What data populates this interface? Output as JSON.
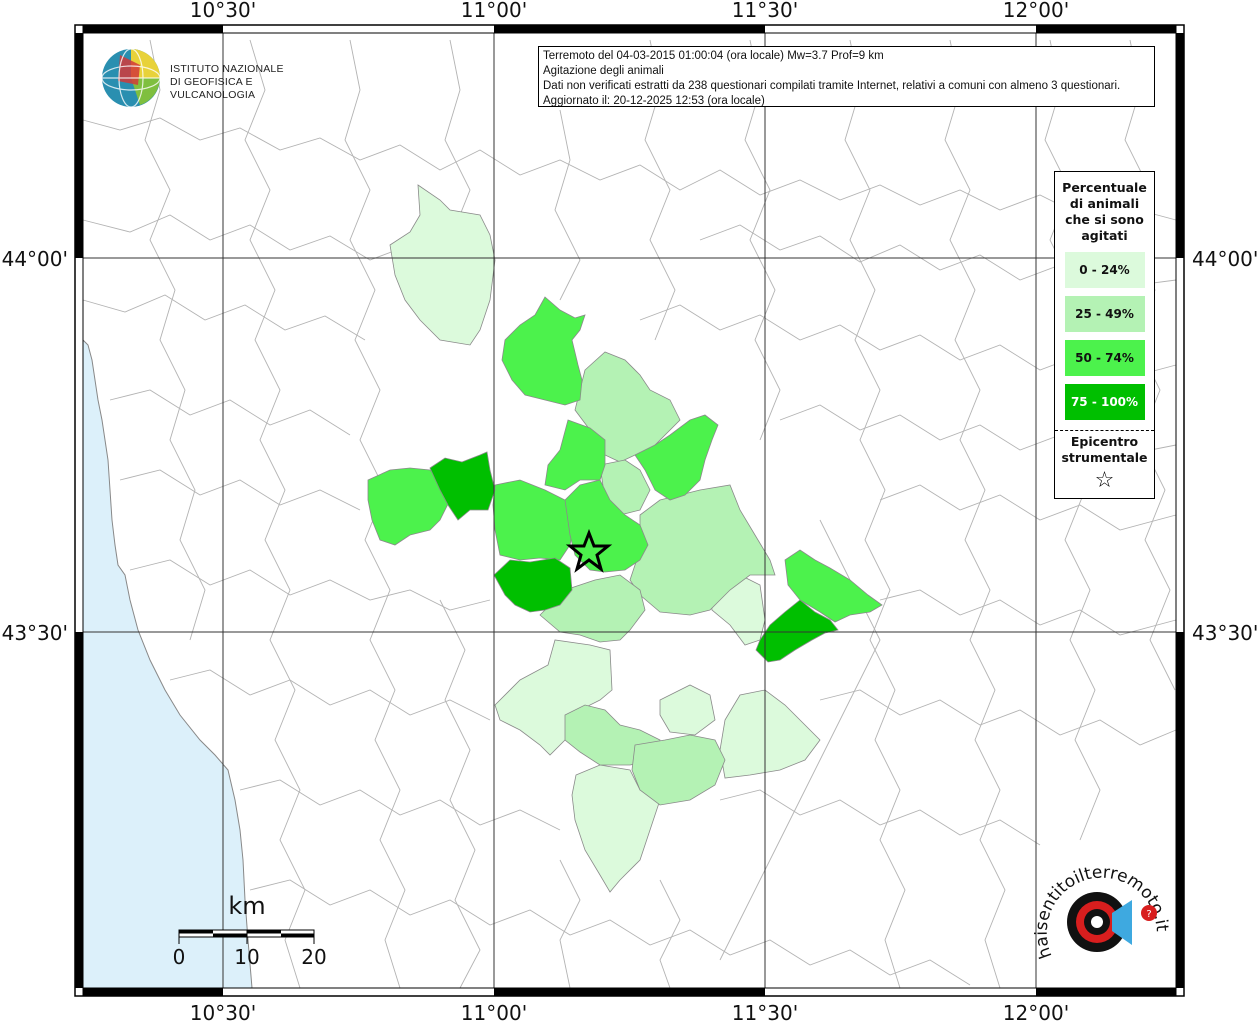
{
  "info": {
    "line1": "Terremoto del 04-03-2015 01:00:04 (ora locale) Mw=3.7 Prof=9 km",
    "line2": "Agitazione degli animali",
    "line3": "Dati non verificati estratti da 238 questionari compilati tramite Internet, relativi a comuni con almeno 3 questionari.",
    "line4": "Aggiornato il: 20-12-2025 12:53 (ora locale)"
  },
  "legend": {
    "title": "Percentuale di animali che si sono agitati",
    "items": [
      {
        "label": "0 - 24%",
        "color": "#dcfadc"
      },
      {
        "label": "25 - 49%",
        "color": "#b4f2b4"
      },
      {
        "label": "50 - 74%",
        "color": "#4cf24c"
      },
      {
        "label": "75 - 100%",
        "color": "#00bf00"
      }
    ],
    "epicenter_label": "Epicentro strumentale",
    "epicenter_symbol": "☆"
  },
  "axes": {
    "x_top": [
      "10°30'",
      "11°00'",
      "11°30'",
      "12°00'"
    ],
    "x_bottom": [
      "10°30'",
      "11°00'",
      "11°30'",
      "12°00'"
    ],
    "y_left": [
      "44°00'",
      "43°30'"
    ],
    "y_right": [
      "44°00'",
      "43°30'"
    ]
  },
  "scale_bar": {
    "unit": "km",
    "ticks": [
      "0",
      "10",
      "20"
    ]
  },
  "logos": {
    "ingv_line1": "ISTITUTO NAZIONALE",
    "ingv_line2": "DI GEOFISICA E VULCANOLOGIA",
    "hst_text": "haisentitoilterremoto.it"
  },
  "colors": {
    "sea": "#dcf0fa",
    "land": "#ffffff",
    "border": "#aaaaaa",
    "grid": "#333333"
  }
}
